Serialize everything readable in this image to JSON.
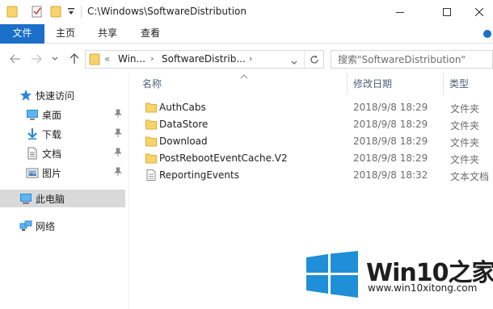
{
  "window": {
    "title": "C:\\Windows\\SoftwareDistribution",
    "controls": [
      "minimize",
      "maximize",
      "close"
    ]
  },
  "quick_access_toolbar": [
    "folder-icon",
    "properties-check-icon",
    "new-folder-icon",
    "customize-dropdown-icon"
  ],
  "ribbon": {
    "tabs": [
      {
        "label": "文件",
        "active": true
      },
      {
        "label": "主页"
      },
      {
        "label": "共享"
      },
      {
        "label": "查看"
      }
    ]
  },
  "address_bar": {
    "prefix": "«",
    "segments": [
      "Win...",
      "SoftwareDistrib..."
    ],
    "search_placeholder": "搜索\"SoftwareDistribution\""
  },
  "nav_pane": {
    "quick_access": {
      "label": "快速访问",
      "icon": "star-icon"
    },
    "pinned": [
      {
        "label": "桌面",
        "icon": "desktop-icon"
      },
      {
        "label": "下载",
        "icon": "download-arrow-icon"
      },
      {
        "label": "文档",
        "icon": "documents-icon"
      },
      {
        "label": "图片",
        "icon": "pictures-icon"
      }
    ],
    "this_pc": {
      "label": "此电脑",
      "icon": "computer-icon",
      "selected": true
    },
    "network": {
      "label": "网络",
      "icon": "network-icon"
    }
  },
  "file_list": {
    "columns": {
      "name": "名称",
      "date": "修改日期",
      "type": "类型"
    },
    "rows": [
      {
        "name": "AuthCabs",
        "date": "2018/9/8 18:29",
        "type": "文件夹",
        "icon": "folder-icon"
      },
      {
        "name": "DataStore",
        "date": "2018/9/8 18:29",
        "type": "文件夹",
        "icon": "folder-icon"
      },
      {
        "name": "Download",
        "date": "2018/9/8 18:29",
        "type": "文件夹",
        "icon": "folder-icon"
      },
      {
        "name": "PostRebootEventCache.V2",
        "date": "2018/9/8 18:29",
        "type": "文件夹",
        "icon": "folder-icon"
      },
      {
        "name": "ReportingEvents",
        "date": "2018/9/8 18:32",
        "type": "文本文档",
        "icon": "text-file-icon"
      }
    ]
  },
  "watermark": {
    "title": "Win10之家",
    "url": "www.win10xitong.com"
  },
  "colors": {
    "accent": "#1a6fc9",
    "folder": "#f2c94c",
    "selection": "#d9d9d9",
    "windows_logo": "#1e8fd8"
  }
}
